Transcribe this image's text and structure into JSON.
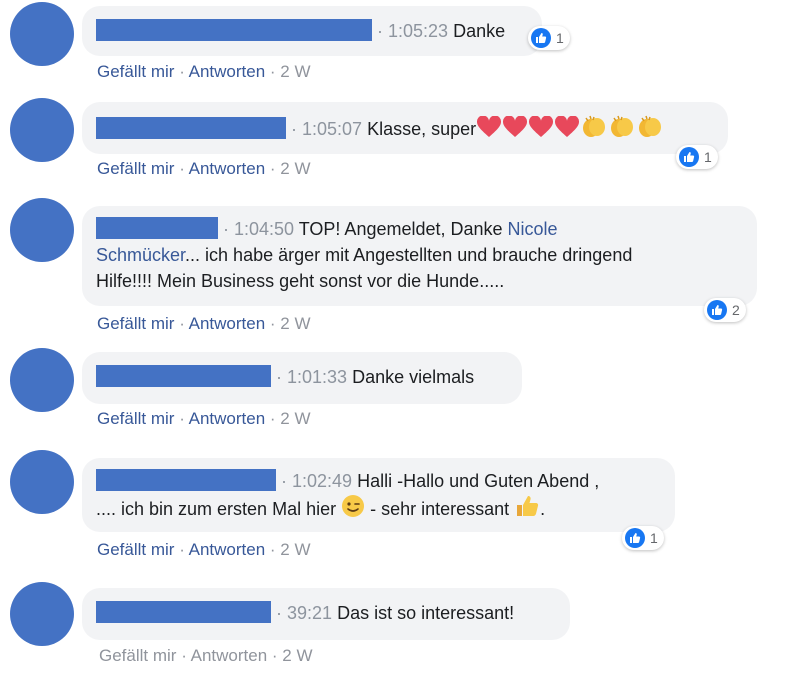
{
  "comments": [
    {
      "time": "1:05:23",
      "text": "Danke",
      "like_count": "1",
      "actions": {
        "like": "Gefällt mir",
        "reply": "Antworten",
        "age": "2 W"
      }
    },
    {
      "time": "1:05:07",
      "text": "Klasse, super",
      "emojis": [
        "heart",
        "heart",
        "heart",
        "heart",
        "clapping-hands",
        "clapping-hands",
        "clapping-hands"
      ],
      "like_count": "1",
      "actions": {
        "like": "Gefällt mir",
        "reply": "Antworten",
        "age": "2 W"
      }
    },
    {
      "time": "1:04:50",
      "text_before_mention": "TOP! Angemeldet, Danke ",
      "mention_part1": "Nicole",
      "mention_part2": "Schmücker",
      "text_after_mention": "... ich habe ärger mit Angestellten und brauche dringend",
      "text_line3": "Hilfe!!!! Mein Business geht sonst vor die Hunde.....",
      "like_count": "2",
      "actions": {
        "like": "Gefällt mir",
        "reply": "Antworten",
        "age": "2 W"
      }
    },
    {
      "time": "1:01:33",
      "text": "Danke vielmals",
      "actions": {
        "like": "Gefällt mir",
        "reply": "Antworten",
        "age": "2 W"
      }
    },
    {
      "time": "1:02:49",
      "text_line1": "Halli -Hallo und Guten Abend ,",
      "text_line2a": ".... ich bin zum ersten Mal hier ",
      "text_line2b": " - sehr interessant ",
      "text_line2c": ".",
      "emojis": [
        "winking-smiley",
        "thumbs-up-hand"
      ],
      "like_count": "1",
      "actions": {
        "like": "Gefällt mir",
        "reply": "Antworten",
        "age": "2 W"
      }
    },
    {
      "time": "39:21",
      "text": "Das ist so interessant!",
      "actions": {
        "like": "Gefällt mir",
        "reply": "Antworten",
        "age": "2 W"
      }
    }
  ],
  "separator": " · ",
  "colors": {
    "name_redaction": "#4472c4",
    "avatar": "#4472c4",
    "like_blue": "#1877f2",
    "link": "#385898",
    "bubble": "#f2f3f5"
  }
}
